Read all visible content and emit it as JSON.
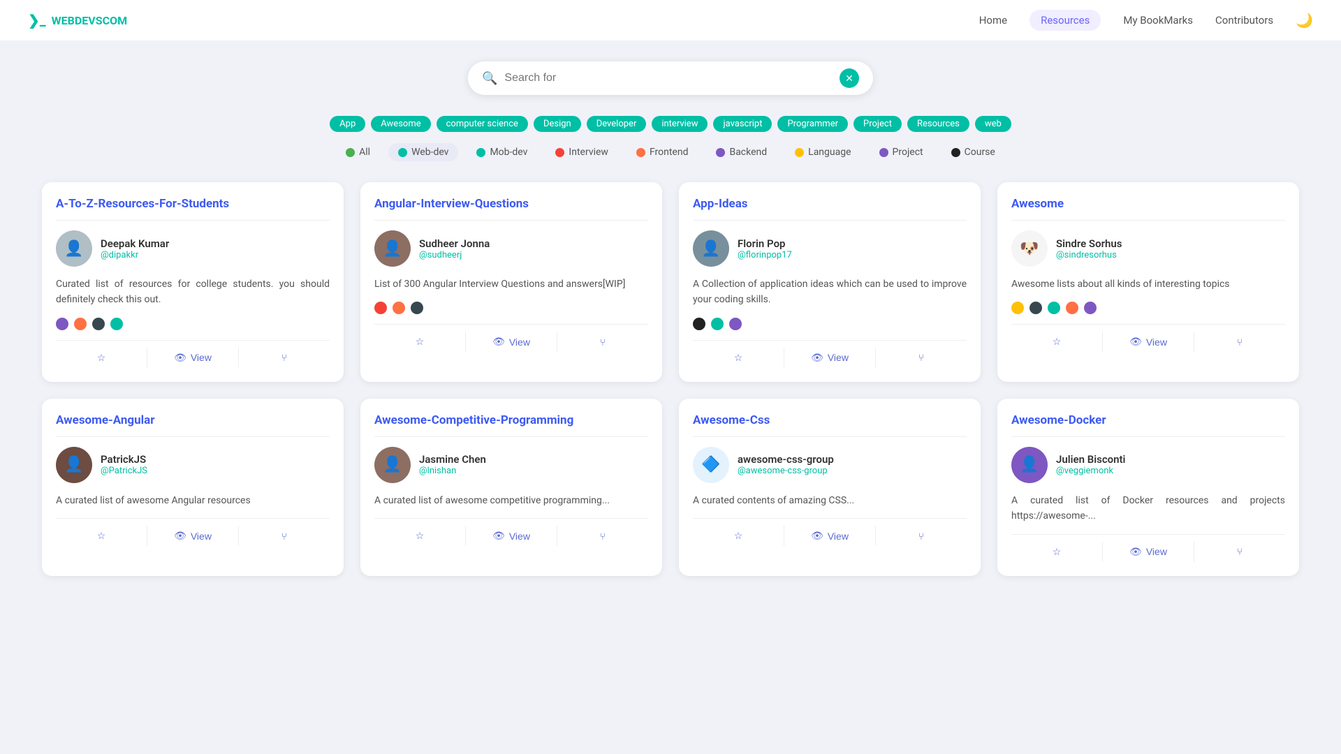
{
  "brand": {
    "name": "WEBDEVSCOM",
    "logo_icon": "❯_"
  },
  "nav": {
    "links": [
      {
        "label": "Home",
        "active": false
      },
      {
        "label": "Resources",
        "active": true
      },
      {
        "label": "My BookMarks",
        "active": false
      },
      {
        "label": "Contributors",
        "active": false
      }
    ],
    "moon_icon": "🌙"
  },
  "search": {
    "placeholder": "Search for",
    "clear_label": "✕"
  },
  "tag_filters": [
    "App",
    "Awesome",
    "computer science",
    "Design",
    "Developer",
    "interview",
    "javascript",
    "Programmer",
    "Project",
    "Resources",
    "web"
  ],
  "category_filters": [
    {
      "label": "All",
      "color": "#4caf50",
      "active": false
    },
    {
      "label": "Web-dev",
      "color": "#00bfa5",
      "active": true
    },
    {
      "label": "Mob-dev",
      "color": "#00bfa5",
      "active": false
    },
    {
      "label": "Interview",
      "color": "#f44336",
      "active": false
    },
    {
      "label": "Frontend",
      "color": "#ff7043",
      "active": false
    },
    {
      "label": "Backend",
      "color": "#7e57c2",
      "active": false
    },
    {
      "label": "Language",
      "color": "#ffc107",
      "active": false
    },
    {
      "label": "Project",
      "color": "#7e57c2",
      "active": false
    },
    {
      "label": "Course",
      "color": "#212121",
      "active": false
    }
  ],
  "cards": [
    {
      "title": "A-To-Z-Resources-For-Students",
      "author_name": "Deepak Kumar",
      "author_handle": "@dipakkr",
      "avatar_emoji": "👤",
      "avatar_bg": "#b0bec5",
      "description": "Curated list of resources for college students. you should definitely check this out.",
      "tags": [
        "#7e57c2",
        "#ff7043",
        "#37474f",
        "#00bfa5"
      ]
    },
    {
      "title": "Angular-Interview-Questions",
      "author_name": "Sudheer Jonna",
      "author_handle": "@sudheerj",
      "avatar_emoji": "👤",
      "avatar_bg": "#8d6e63",
      "description": "List of 300 Angular Interview Questions and answers[WIP]",
      "tags": [
        "#f44336",
        "#ff7043",
        "#37474f"
      ]
    },
    {
      "title": "App-Ideas",
      "author_name": "Florin Pop",
      "author_handle": "@florinpop17",
      "avatar_emoji": "👤",
      "avatar_bg": "#78909c",
      "description": "A Collection of application ideas which can be used to improve your coding skills.",
      "tags": [
        "#212121",
        "#00bfa5",
        "#7e57c2"
      ]
    },
    {
      "title": "Awesome",
      "author_name": "Sindre Sorhus",
      "author_handle": "@sindresorhus",
      "avatar_emoji": "🐶",
      "avatar_bg": "#f5f5f5",
      "description": "Awesome lists about all kinds of interesting topics",
      "tags": [
        "#ffc107",
        "#37474f",
        "#00bfa5",
        "#ff7043",
        "#7e57c2"
      ]
    },
    {
      "title": "Awesome-Angular",
      "author_name": "PatrickJS",
      "author_handle": "@PatrickJS",
      "avatar_emoji": "👤",
      "avatar_bg": "#6d4c41",
      "description": "A curated list of awesome Angular resources",
      "tags": []
    },
    {
      "title": "Awesome-Competitive-Programming",
      "author_name": "Jasmine Chen",
      "author_handle": "@lnishan",
      "avatar_emoji": "👤",
      "avatar_bg": "#8d6e63",
      "description": "A curated list of awesome competitive programming...",
      "tags": []
    },
    {
      "title": "Awesome-Css",
      "author_name": "awesome-css-group",
      "author_handle": "@awesome-css-group",
      "avatar_emoji": "🔷",
      "avatar_bg": "#e3f2fd",
      "description": "A curated contents of amazing CSS...",
      "tags": []
    },
    {
      "title": "Awesome-Docker",
      "author_name": "Julien Bisconti",
      "author_handle": "@veggiemonk",
      "avatar_emoji": "👤",
      "avatar_bg": "#7e57c2",
      "description": "A curated list of Docker resources and projects https://awesome-...",
      "tags": []
    }
  ],
  "actions": {
    "star_icon": "☆",
    "view_icon": "👁",
    "view_label": "View",
    "fork_icon": "⑂"
  }
}
